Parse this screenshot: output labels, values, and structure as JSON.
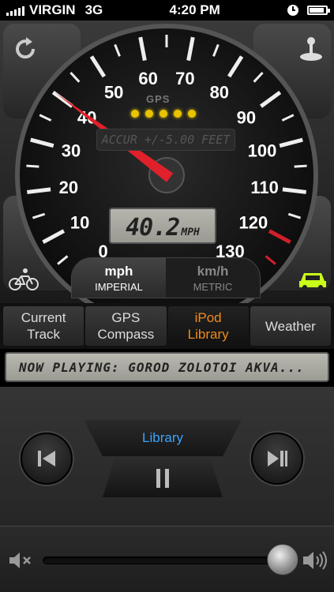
{
  "status_bar": {
    "carrier": "VIRGIN",
    "network": "3G",
    "time": "4:20 PM"
  },
  "gauge": {
    "ticks": [
      "0",
      "10",
      "20",
      "30",
      "40",
      "50",
      "60",
      "70",
      "80",
      "90",
      "100",
      "110",
      "120",
      "130"
    ],
    "gps_label": "GPS",
    "accuracy_text": "ACCUR +/-5.00 FEET",
    "speed": "40.2",
    "speed_unit": "MPH",
    "redline_color": "#d0202a",
    "needle_color": "#e0202a"
  },
  "unit_toggle": {
    "imperial": {
      "main": "mph",
      "sub": "IMPERIAL"
    },
    "metric": {
      "main": "km/h",
      "sub": "METRIC"
    }
  },
  "icons": {
    "top_left": "reset-icon",
    "top_right": "joystick-icon",
    "bottom_left": "bicycle-icon",
    "bottom_right": "car-icon"
  },
  "tabs": [
    {
      "label": "Current\nTrack"
    },
    {
      "label": "GPS\nCompass"
    },
    {
      "label": "iPod\nLibrary"
    },
    {
      "label": "Weather"
    }
  ],
  "now_playing": "NOW PLAYING: GOROD ZOLOTOI AKVA...",
  "player": {
    "library_label": "Library"
  },
  "accent_color": "#f08a1c"
}
